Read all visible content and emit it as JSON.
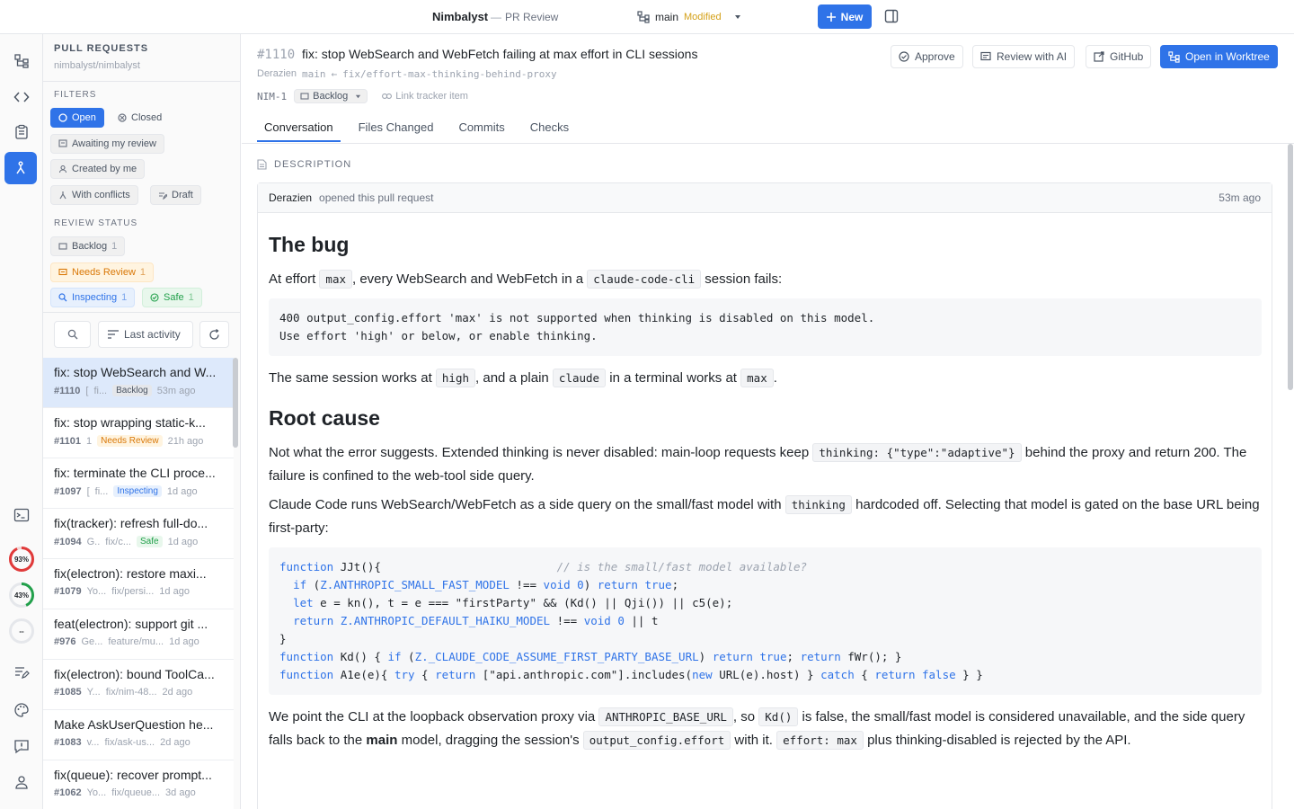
{
  "topbar": {
    "app_name": "Nimbalyst",
    "separator": "—",
    "section": "PR Review",
    "branch": "main",
    "branch_status": "Modified",
    "new_label": "New"
  },
  "left_panel": {
    "title": "PULL REQUESTS",
    "repo": "nimbalyst/nimbalyst",
    "filters_label": "FILTERS",
    "filters": {
      "open": "Open",
      "closed": "Closed",
      "awaiting": "Awaiting my review",
      "created": "Created by me",
      "conflicts": "With conflicts",
      "draft": "Draft"
    },
    "review_status_label": "REVIEW STATUS",
    "review_status": [
      {
        "label": "Backlog",
        "count": "1"
      },
      {
        "label": "Needs Review",
        "count": "1"
      },
      {
        "label": "Inspecting",
        "count": "1"
      },
      {
        "label": "Safe",
        "count": "1"
      }
    ],
    "sort_label": "Last activity",
    "prs": [
      {
        "title": "fix: stop WebSearch and W...",
        "number": "#1110",
        "author": "[",
        "branch": "fi...",
        "badge": "Backlog",
        "time": "53m ago"
      },
      {
        "title": "fix: stop wrapping static-k...",
        "number": "#1101",
        "author": "1",
        "branch": "",
        "badge": "Needs Review",
        "time": "21h ago"
      },
      {
        "title": "fix: terminate the CLI proce...",
        "number": "#1097",
        "author": "[",
        "branch": "fi...",
        "badge": "Inspecting",
        "time": "1d ago"
      },
      {
        "title": "fix(tracker): refresh full-do...",
        "number": "#1094",
        "author": "G..",
        "branch": "fix/c...",
        "badge": "Safe",
        "time": "1d ago"
      },
      {
        "title": "fix(electron): restore maxi...",
        "number": "#1079",
        "author": "Yo...",
        "branch": "fix/persi...",
        "badge": "",
        "time": "1d ago"
      },
      {
        "title": "feat(electron): support git ...",
        "number": "#976",
        "author": "Ge...",
        "branch": "feature/mu...",
        "badge": "",
        "time": "1d ago"
      },
      {
        "title": "fix(electron): bound ToolCa...",
        "number": "#1085",
        "author": "Y...",
        "branch": "fix/nim-48...",
        "badge": "",
        "time": "2d ago"
      },
      {
        "title": "Make AskUserQuestion he...",
        "number": "#1083",
        "author": "v...",
        "branch": "fix/ask-us...",
        "badge": "",
        "time": "2d ago"
      },
      {
        "title": "fix(queue): recover prompt...",
        "number": "#1062",
        "author": "Yo...",
        "branch": "fix/queue...",
        "badge": "",
        "time": "3d ago"
      }
    ]
  },
  "rail": {
    "usage_a": "93%",
    "usage_b": "43%",
    "usage_c": "--"
  },
  "pr": {
    "number": "#1110",
    "title": "fix: stop WebSearch and WebFetch failing at max effort in CLI sessions",
    "author": "Derazien",
    "base": "main",
    "arrow": "←",
    "head": "fix/effort-max-thinking-behind-proxy",
    "tracker_id": "NIM-1",
    "tracker_status": "Backlog",
    "link_tracker": "Link tracker item",
    "actions": {
      "approve": "Approve",
      "review_ai": "Review with AI",
      "github": "GitHub",
      "worktree": "Open in Worktree"
    },
    "tabs": [
      "Conversation",
      "Files Changed",
      "Commits",
      "Checks"
    ]
  },
  "description": {
    "label": "DESCRIPTION",
    "author": "Derazien",
    "action": "opened this pull request",
    "time": "53m ago",
    "h_bug": "The bug",
    "p1_a": "At effort ",
    "p1_code1": "max",
    "p1_b": ", every WebSearch and WebFetch in a ",
    "p1_code2": "claude-code-cli",
    "p1_c": " session fails:",
    "err_line1": "400 output_config.effort 'max' is not supported when thinking is disabled on this model.",
    "err_line2": "Use effort 'high' or below, or enable thinking.",
    "p2_a": "The same session works at ",
    "p2_code1": "high",
    "p2_b": ", and a plain ",
    "p2_code2": "claude",
    "p2_c": " in a terminal works at ",
    "p2_code3": "max",
    "p2_d": ".",
    "h_root": "Root cause",
    "p3_a": "Not what the error suggests. Extended thinking is never disabled: main-loop requests keep ",
    "p3_code": "thinking: {\"type\":\"adaptive\"}",
    "p3_b": " behind the proxy and return 200. The failure is confined to the web-tool side query.",
    "p4_a": "Claude Code runs WebSearch/WebFetch as a side query on the small/fast model with ",
    "p4_code": "thinking",
    "p4_b": " hardcoded off. Selecting that model is gated on the base URL being first-party:",
    "p5_a": "We point the CLI at the loopback observation proxy via ",
    "p5_code1": "ANTHROPIC_BASE_URL",
    "p5_b": ", so ",
    "p5_code2": "Kd()",
    "p5_c": " is false, the small/fast model is considered unavailable, and the side query falls back to the ",
    "p5_bold": "main",
    "p5_d": " model, dragging the session's ",
    "p5_code3": "output_config.effort",
    "p5_e": " with it. ",
    "p5_code4": "effort: max",
    "p5_f": " plus thinking-disabled is rejected by the API."
  }
}
